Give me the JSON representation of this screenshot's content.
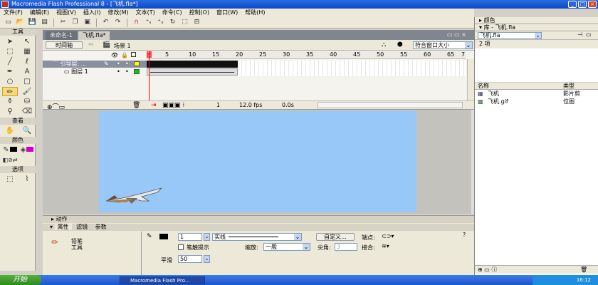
{
  "window": {
    "title": "Macromedia Flash Professional 8 - [飞机.fla*]"
  },
  "menu": [
    "文件(F)",
    "编辑(E)",
    "视图(V)",
    "插入(I)",
    "修改(M)",
    "文本(T)",
    "命令(C)",
    "控制(O)",
    "窗口(W)",
    "帮助(H)"
  ],
  "tools": {
    "title": "工具",
    "view_label": "查看",
    "colors_label": "颜色",
    "options_label": "选项"
  },
  "document": {
    "tabs": [
      "未命名-1",
      "飞机.fla*"
    ],
    "timeline_button": "时间轴",
    "scene": "场景 1",
    "zoom": "符合窗口大小",
    "frame_numbers": [
      "1",
      "5",
      "10",
      "15",
      "20",
      "25",
      "30",
      "35",
      "40",
      "45",
      "50",
      "55",
      "60",
      "65",
      "7"
    ],
    "layers": [
      {
        "name": "引导层: ..."
      },
      {
        "name": "图层 1"
      }
    ],
    "status": {
      "frame": "1",
      "fps": "12.0 fps",
      "time": "0.0s"
    }
  },
  "library": {
    "color_panel": "颜色",
    "title": "库 - 飞机.fla",
    "dropdown": "飞机.fla",
    "count": "2 项",
    "col_name": "名称",
    "col_type": "类型",
    "items": [
      {
        "name": "飞机",
        "type": "影片剪"
      },
      {
        "name": "飞机.gif",
        "type": "位图"
      }
    ]
  },
  "actions_panel": "动作",
  "properties": {
    "tabs": [
      "属性",
      "滤镜",
      "参数"
    ],
    "tool_name": "铅笔",
    "tool_sub": "工具",
    "stroke_width": "1",
    "stroke_style": "实线",
    "custom_button": "自定义...",
    "endpoint_label": "端点:",
    "stroke_hint_label": "笔触提示",
    "scale_label": "缩放:",
    "scale_value": "一般",
    "miter_label": "尖角:",
    "miter_value": "3",
    "join_label": "接合:",
    "smooth_label": "平滑",
    "smooth_value": "50"
  },
  "taskbar": {
    "start": "开始",
    "app": "Macromedia Flash Pro...",
    "clock": "16:12"
  }
}
